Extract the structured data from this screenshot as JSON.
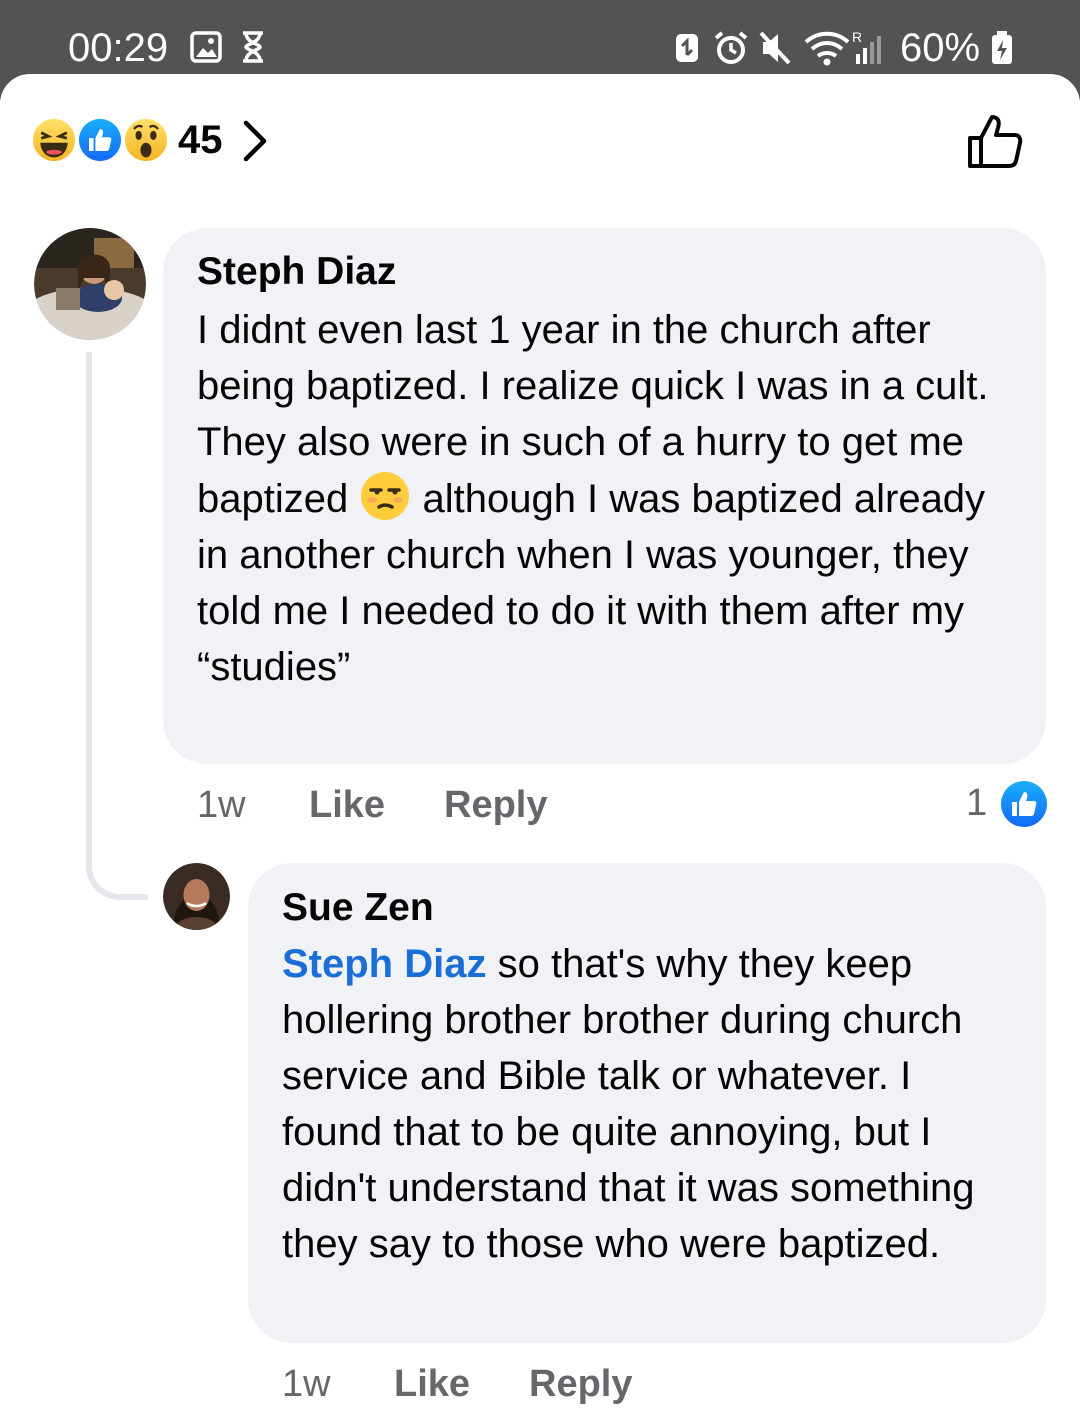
{
  "status_bar": {
    "time": "00:29",
    "battery": "60%",
    "icons": [
      "image-icon",
      "hourglass-icon",
      "sync-icon",
      "alarm-icon",
      "mute-icon",
      "wifi-icon",
      "signal-icon",
      "battery-icon"
    ]
  },
  "reactions": {
    "icons": [
      "laugh-emoji",
      "like-emoji",
      "wow-emoji"
    ],
    "count": "45"
  },
  "comments": [
    {
      "author": "Steph Diaz",
      "body_before_emoji": "I didnt even last 1 year in the church after being baptized. I realize quick I was in a cult. They also were in such of a hurry to get me baptized ",
      "emoji": "unamused-face",
      "body_after_emoji": " although I was baptized already in another church when I was younger, they told me I needed to do it with them after my “studies”",
      "time": "1w",
      "like_label": "Like",
      "reply_label": "Reply",
      "reaction_count": "1"
    },
    {
      "author": "Sue Zen",
      "mention": "Steph Diaz",
      "body": " so that's why they keep hollering brother brother during church service and Bible talk or whatever. I found that to be quite annoying, but I didn't understand that it was something they say to those who were baptized.",
      "time": "1w",
      "like_label": "Like",
      "reply_label": "Reply"
    }
  ],
  "colors": {
    "status_bar": "#535353",
    "bubble": "#f0f2f5",
    "mention": "#1a6ed8",
    "like_blue": "#1877f2",
    "meta_gray": "#65676b"
  }
}
